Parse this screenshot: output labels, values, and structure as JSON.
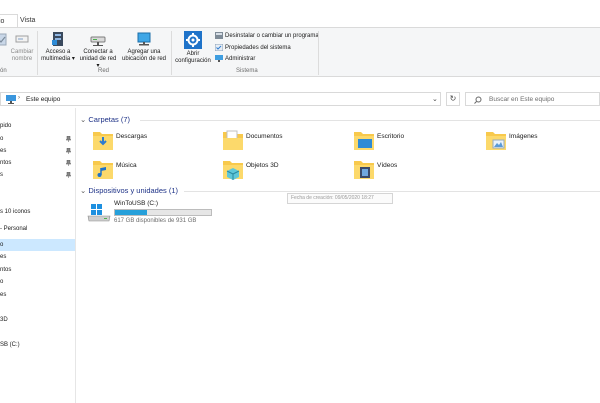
{
  "tabs": {
    "active": "io",
    "vista": "Vista"
  },
  "ribbon": {
    "rename": {
      "line1": "Cambiar",
      "line2": "nombre"
    },
    "left_group_label": "ón",
    "media": {
      "line1": "Acceso a",
      "line2": "multimedia ▾"
    },
    "map_drive": {
      "line1": "Conectar a",
      "line2": "unidad de red ▾"
    },
    "add_location": {
      "line1": "Agregar una",
      "line2": "ubicación de red"
    },
    "red_label": "Red",
    "open_config": {
      "line1": "Abrir",
      "line2": "configuración"
    },
    "uninstall": "Desinstalar o cambiar un programa",
    "properties": "Propiedades del sistema",
    "manage": "Administrar",
    "sistema_label": "Sistema"
  },
  "address": {
    "path": "Este equipo",
    "search_placeholder": "Buscar en Este equipo"
  },
  "nav": {
    "items": [
      "pido",
      "o",
      "es",
      "ntos",
      "s",
      "s 10 iconos",
      "- Personal",
      "o",
      "es",
      "ntos",
      "o",
      "es",
      "3D",
      "SB (C:)"
    ]
  },
  "content": {
    "folders_header": "Carpetas (7)",
    "folders": [
      "Descargas",
      "Documentos",
      "Escritorio",
      "Imágenes",
      "Música",
      "Objetos 3D",
      "Vídeos"
    ],
    "devices_header": "Dispositivos y unidades (1)",
    "drive": {
      "name": "WinToUSB (C:)",
      "free": "617 GB disponibles de 931 GB",
      "used_fraction": 0.337
    },
    "tooltip": "Fecha de creación: 09/05/2020 18:27"
  },
  "colors": {
    "accent": "#1e3287",
    "selection": "#cce8ff",
    "drive_fill": "#26a0da",
    "folder": "#f8c94c"
  }
}
